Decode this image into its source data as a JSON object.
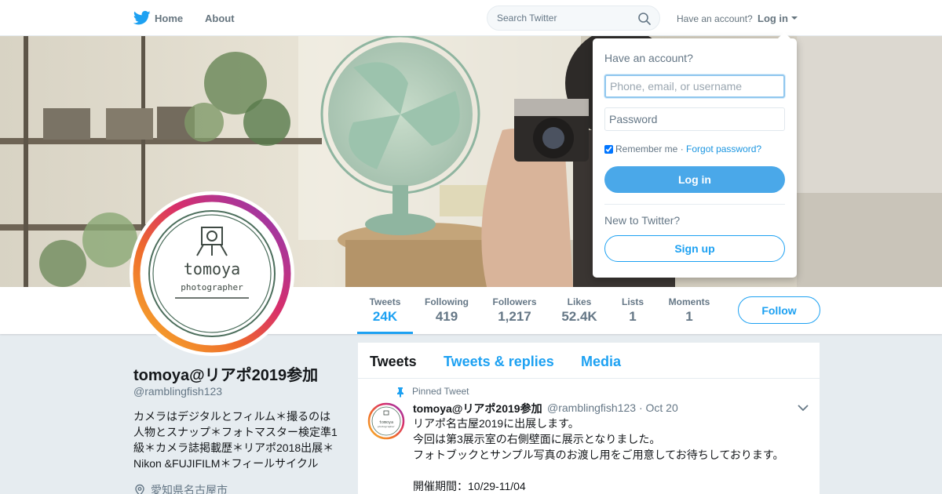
{
  "nav": {
    "home": "Home",
    "about": "About",
    "search_placeholder": "Search Twitter",
    "have_account": "Have an account?",
    "login": "Log in"
  },
  "profile": {
    "name": "tomoya@リアポ2019参加",
    "handle": "@ramblingfish123",
    "bio": "カメラはデジタルとフィルム＊撮るのは人物とスナップ＊フォトマスター検定準1級＊カメラ誌掲載歴＊リアポ2018出展＊Nikon &FUJIFILM＊フィールサイクル",
    "location": "愛知県名古屋市",
    "avatar_text": "tomoya",
    "avatar_subtext": "photographer"
  },
  "stats": [
    {
      "label": "Tweets",
      "value": "24K"
    },
    {
      "label": "Following",
      "value": "419"
    },
    {
      "label": "Followers",
      "value": "1,217"
    },
    {
      "label": "Likes",
      "value": "52.4K"
    },
    {
      "label": "Lists",
      "value": "1"
    },
    {
      "label": "Moments",
      "value": "1"
    }
  ],
  "follow_label": "Follow",
  "tabs": [
    "Tweets",
    "Tweets & replies",
    "Media"
  ],
  "tweet": {
    "pinned_label": "Pinned Tweet",
    "name": "tomoya@リアポ2019参加",
    "handle": "@ramblingfish123",
    "sep": "·",
    "date": "Oct 20",
    "lines": [
      "リアポ名古屋2019に出展します。",
      "今回は第3展示室の右側壁面に展示となりました。",
      "フォトブックとサンプル写真のお渡し用をご用意してお待ちしております。",
      "",
      "開催期間：10/29-11/04"
    ]
  },
  "login_dropdown": {
    "title": "Have an account?",
    "username_placeholder": "Phone, email, or username",
    "password_placeholder": "Password",
    "remember": "Remember me",
    "sep": "·",
    "forgot": "Forgot password?",
    "login_button": "Log in",
    "new_to": "New to Twitter?",
    "signup_button": "Sign up"
  },
  "colors": {
    "accent": "#1da1f2",
    "login_button": "#4aa8e9"
  }
}
